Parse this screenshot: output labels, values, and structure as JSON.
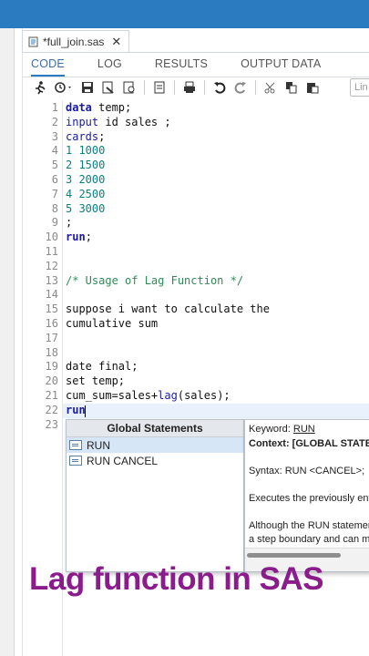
{
  "file_tab": {
    "name": "*full_join.sas",
    "close": "✕"
  },
  "subtabs": [
    "CODE",
    "LOG",
    "RESULTS",
    "OUTPUT DATA"
  ],
  "line_input": {
    "placeholder": "Lin"
  },
  "code_lines": [
    {
      "n": "1",
      "html": "<span class=\"kw\">data</span> temp;"
    },
    {
      "n": "2",
      "html": "<span class=\"kw2\">input</span> id sales ;"
    },
    {
      "n": "3",
      "html": "<span class=\"kw2\">cards</span>;"
    },
    {
      "n": "4",
      "html": "<span class=\"num\">1 1000</span>"
    },
    {
      "n": "5",
      "html": "<span class=\"num\">2 1500</span>"
    },
    {
      "n": "6",
      "html": "<span class=\"num\">3 2000</span>"
    },
    {
      "n": "7",
      "html": "<span class=\"num\">4 2500</span>"
    },
    {
      "n": "8",
      "html": "<span class=\"num\">5 3000</span>"
    },
    {
      "n": "9",
      "html": ";"
    },
    {
      "n": "10",
      "html": "<span class=\"kw\">run</span>;"
    },
    {
      "n": "11",
      "html": ""
    },
    {
      "n": "12",
      "html": ""
    },
    {
      "n": "13",
      "html": "<span class=\"cmt\">/* Usage of Lag Function */</span>"
    },
    {
      "n": "14",
      "html": ""
    },
    {
      "n": "15",
      "html": "suppose i want to calculate the"
    },
    {
      "n": "16",
      "html": "cumulative sum"
    },
    {
      "n": "17",
      "html": ""
    },
    {
      "n": "18",
      "html": ""
    },
    {
      "n": "19",
      "html": "date final;"
    },
    {
      "n": "20",
      "html": "set temp;"
    },
    {
      "n": "21",
      "html": "cum_sum=sales+<span class=\"kw2\">lag</span>(sales);"
    },
    {
      "n": "22",
      "html": "<span class=\"kw\">run</span>"
    },
    {
      "n": "23",
      "html": ""
    }
  ],
  "popup": {
    "header": "Global Statements",
    "items": [
      "RUN",
      "RUN CANCEL"
    ]
  },
  "help": {
    "keyword_label": "Keyword:",
    "keyword": "RUN",
    "context": "Context: [GLOBAL STATEMENT]",
    "syntax": "Syntax: RUN <CANCEL>;",
    "desc": "Executes the previously entered",
    "desc2a": "Although the RUN statement",
    "desc2b": "a step boundary and can mark"
  },
  "caption": "Lag function in SAS",
  "colors": {
    "topbar": "#2b7bc0",
    "caption": "#8b1c8b"
  }
}
